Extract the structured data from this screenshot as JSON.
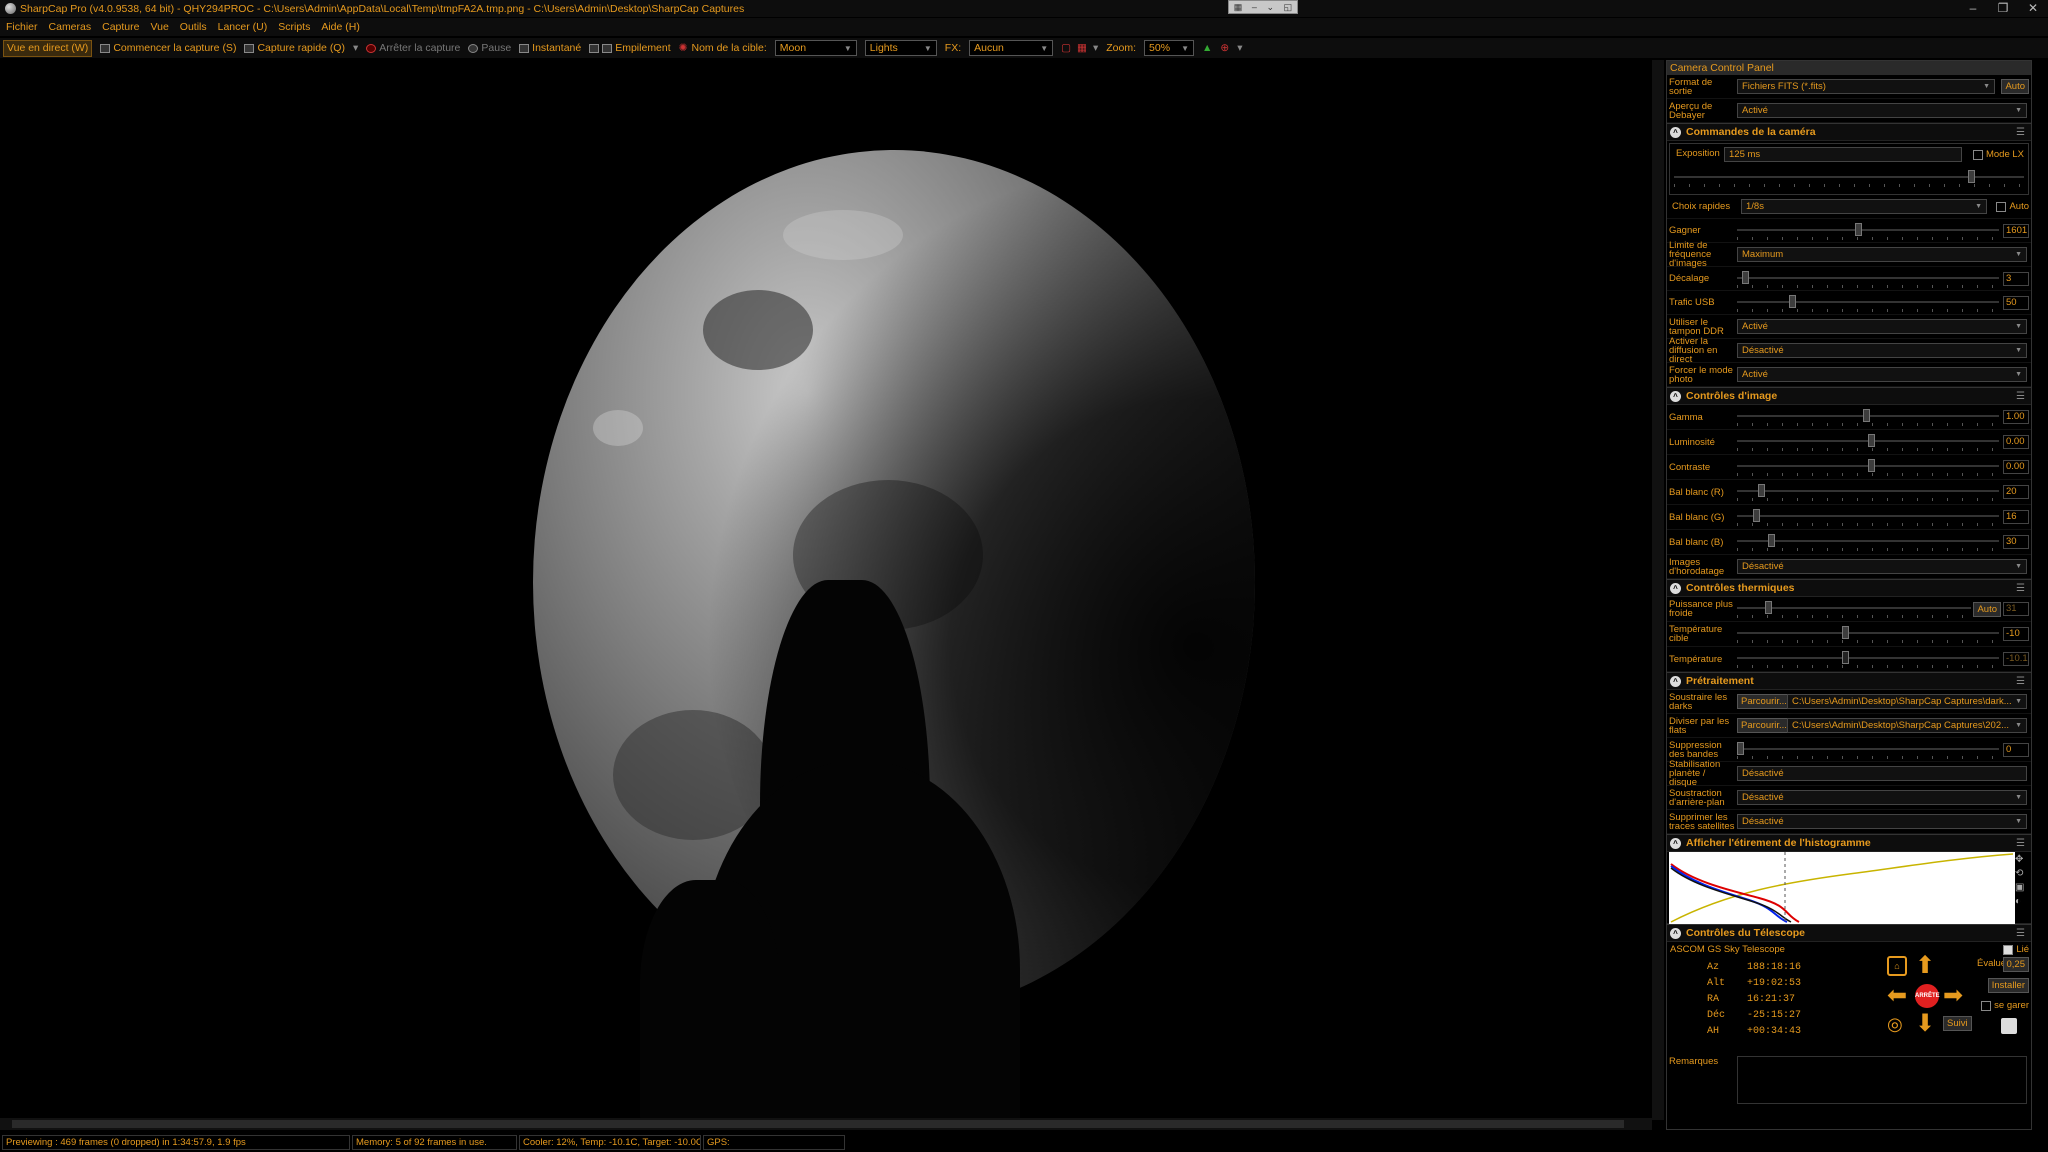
{
  "window": {
    "title": "SharpCap Pro (v4.0.9538, 64 bit) - QHY294PROC - C:\\Users\\Admin\\AppData\\Local\\Temp\\tmpFA2A.tmp.png - C:\\Users\\Admin\\Desktop\\SharpCap Captures",
    "controls": [
      "–",
      "❐",
      "✕"
    ]
  },
  "menu": [
    "Fichier",
    "Cameras",
    "Capture",
    "Vue",
    "Outils",
    "Lancer (U)",
    "Scripts",
    "Aide (H)"
  ],
  "toolbar": {
    "live_view": "Vue en direct (W)",
    "start_capture": "Commencer la capture (S)",
    "quick_capture": "Capture rapide (Q)",
    "stop_capture": "Arrêter la capture",
    "pause": "Pause",
    "snapshot": "Instantané",
    "stacking": "Empilement",
    "target_label": "Nom de la cible:",
    "target_value": "Moon",
    "frame_type": "Lights",
    "fx_label": "FX:",
    "fx_value": "Aucun",
    "zoom_label": "Zoom:",
    "zoom_value": "50%"
  },
  "panel": {
    "title": "Camera Control Panel",
    "output_format_label": "Format de sortie",
    "output_format_value": "Fichiers FITS (*.fits)",
    "auto": "Auto",
    "debayer_label": "Aperçu de Debayer",
    "debayer_value": "Activé",
    "camera_section": "Commandes de la caméra",
    "exposure_label": "Exposition",
    "exposure_value": "125 ms",
    "mode_lx": "Mode LX",
    "quick_choice_label": "Choix rapides",
    "quick_choice_value": "1/8s",
    "quick_auto": "Auto",
    "gain_label": "Gagner",
    "gain_value": "1601",
    "gain_level": 0.45,
    "fps_limit_label": "Limite de fréquence d'images",
    "fps_limit_value": "Maximum",
    "offset_label": "Décalage",
    "offset_value": "3",
    "offset_level": 0.02,
    "usb_label": "Trafic USB",
    "usb_value": "50",
    "usb_level": 0.2,
    "ddr_label": "Utiliser le tampon DDR",
    "ddr_value": "Activé",
    "live_stream_label": "Activer la diffusion en direct",
    "live_stream_value": "Désactivé",
    "photo_mode_label": "Forcer le mode photo",
    "photo_mode_value": "Activé",
    "image_section": "Contrôles d'image",
    "gamma_label": "Gamma",
    "gamma_value": "1.00",
    "gamma_level": 0.48,
    "brightness_label": "Luminosité",
    "brightness_value": "0.00",
    "brightness_level": 0.5,
    "contrast_label": "Contraste",
    "contrast_value": "0.00",
    "contrast_level": 0.5,
    "wb_r_label": "Bal blanc (R)",
    "wb_r_value": "20",
    "wb_r_level": 0.08,
    "wb_g_label": "Bal blanc (G)",
    "wb_g_value": "16",
    "wb_g_level": 0.06,
    "wb_b_label": "Bal blanc (B)",
    "wb_b_value": "30",
    "wb_b_level": 0.12,
    "timestamp_label": "Images d'horodatage",
    "timestamp_value": "Désactivé",
    "thermal_section": "Contrôles thermiques",
    "cooler_label": "Puissance plus froide",
    "cooler_value": "31",
    "cooler_level": 0.12,
    "target_temp_label": "Température cible",
    "target_temp_value": "-10",
    "target_temp_level": 0.4,
    "temp_label": "Température",
    "temp_value": "-10.1",
    "temp_level": 0.4,
    "preproc_section": "Prétraitement",
    "darks_label": "Soustraire les darks",
    "browse": "Parcourir...",
    "darks_path": "C:\\Users\\Admin\\Desktop\\SharpCap Captures\\dark...",
    "flats_label": "Diviser par les flats",
    "flats_path": "C:\\Users\\Admin\\Desktop\\SharpCap Captures\\202...",
    "banding_label": "Suppression des bandes",
    "banding_value": "0",
    "banding_level": 0.0,
    "stabilize_label": "Stabilisation planète / disque",
    "stabilize_value": "Désactivé",
    "bg_sub_label": "Soustraction d'arrière-plan",
    "bg_sub_value": "Désactivé",
    "satellite_label": "Supprimer les traces satellites",
    "satellite_value": "Désactivé",
    "histogram_section": "Afficher l'étirement de l'histogramme",
    "telescope_section": "Contrôles du Télescope",
    "telescope_name": "ASCOM GS Sky Telescope",
    "telescope_link": "Lié",
    "rate_label": "Évaluer:",
    "rate_value": "0,25",
    "install": "Installer",
    "park": "se garer",
    "stop": "ARRÊTE",
    "track": "Suivi",
    "coords": [
      {
        "k": "Az",
        "v": "188:18:16"
      },
      {
        "k": "Alt",
        "v": "+19:02:53"
      },
      {
        "k": "RA",
        "v": "16:21:37"
      },
      {
        "k": "Déc",
        "v": "-25:15:27"
      },
      {
        "k": "AH",
        "v": "+00:34:43"
      }
    ],
    "remarks_label": "Remarques"
  },
  "status": {
    "preview": "Previewing : 469 frames (0 dropped) in 1:34:57.9, 1.9 fps",
    "memory": "Memory: 5 of 92 frames in use.",
    "cooler": "Cooler: 12%, Temp: -10.1C, Target: -10.0C",
    "gps": "GPS:"
  },
  "colors": {
    "accent": "#e69a1e",
    "background": "#000000",
    "histogram_curve": "#c8b400"
  }
}
